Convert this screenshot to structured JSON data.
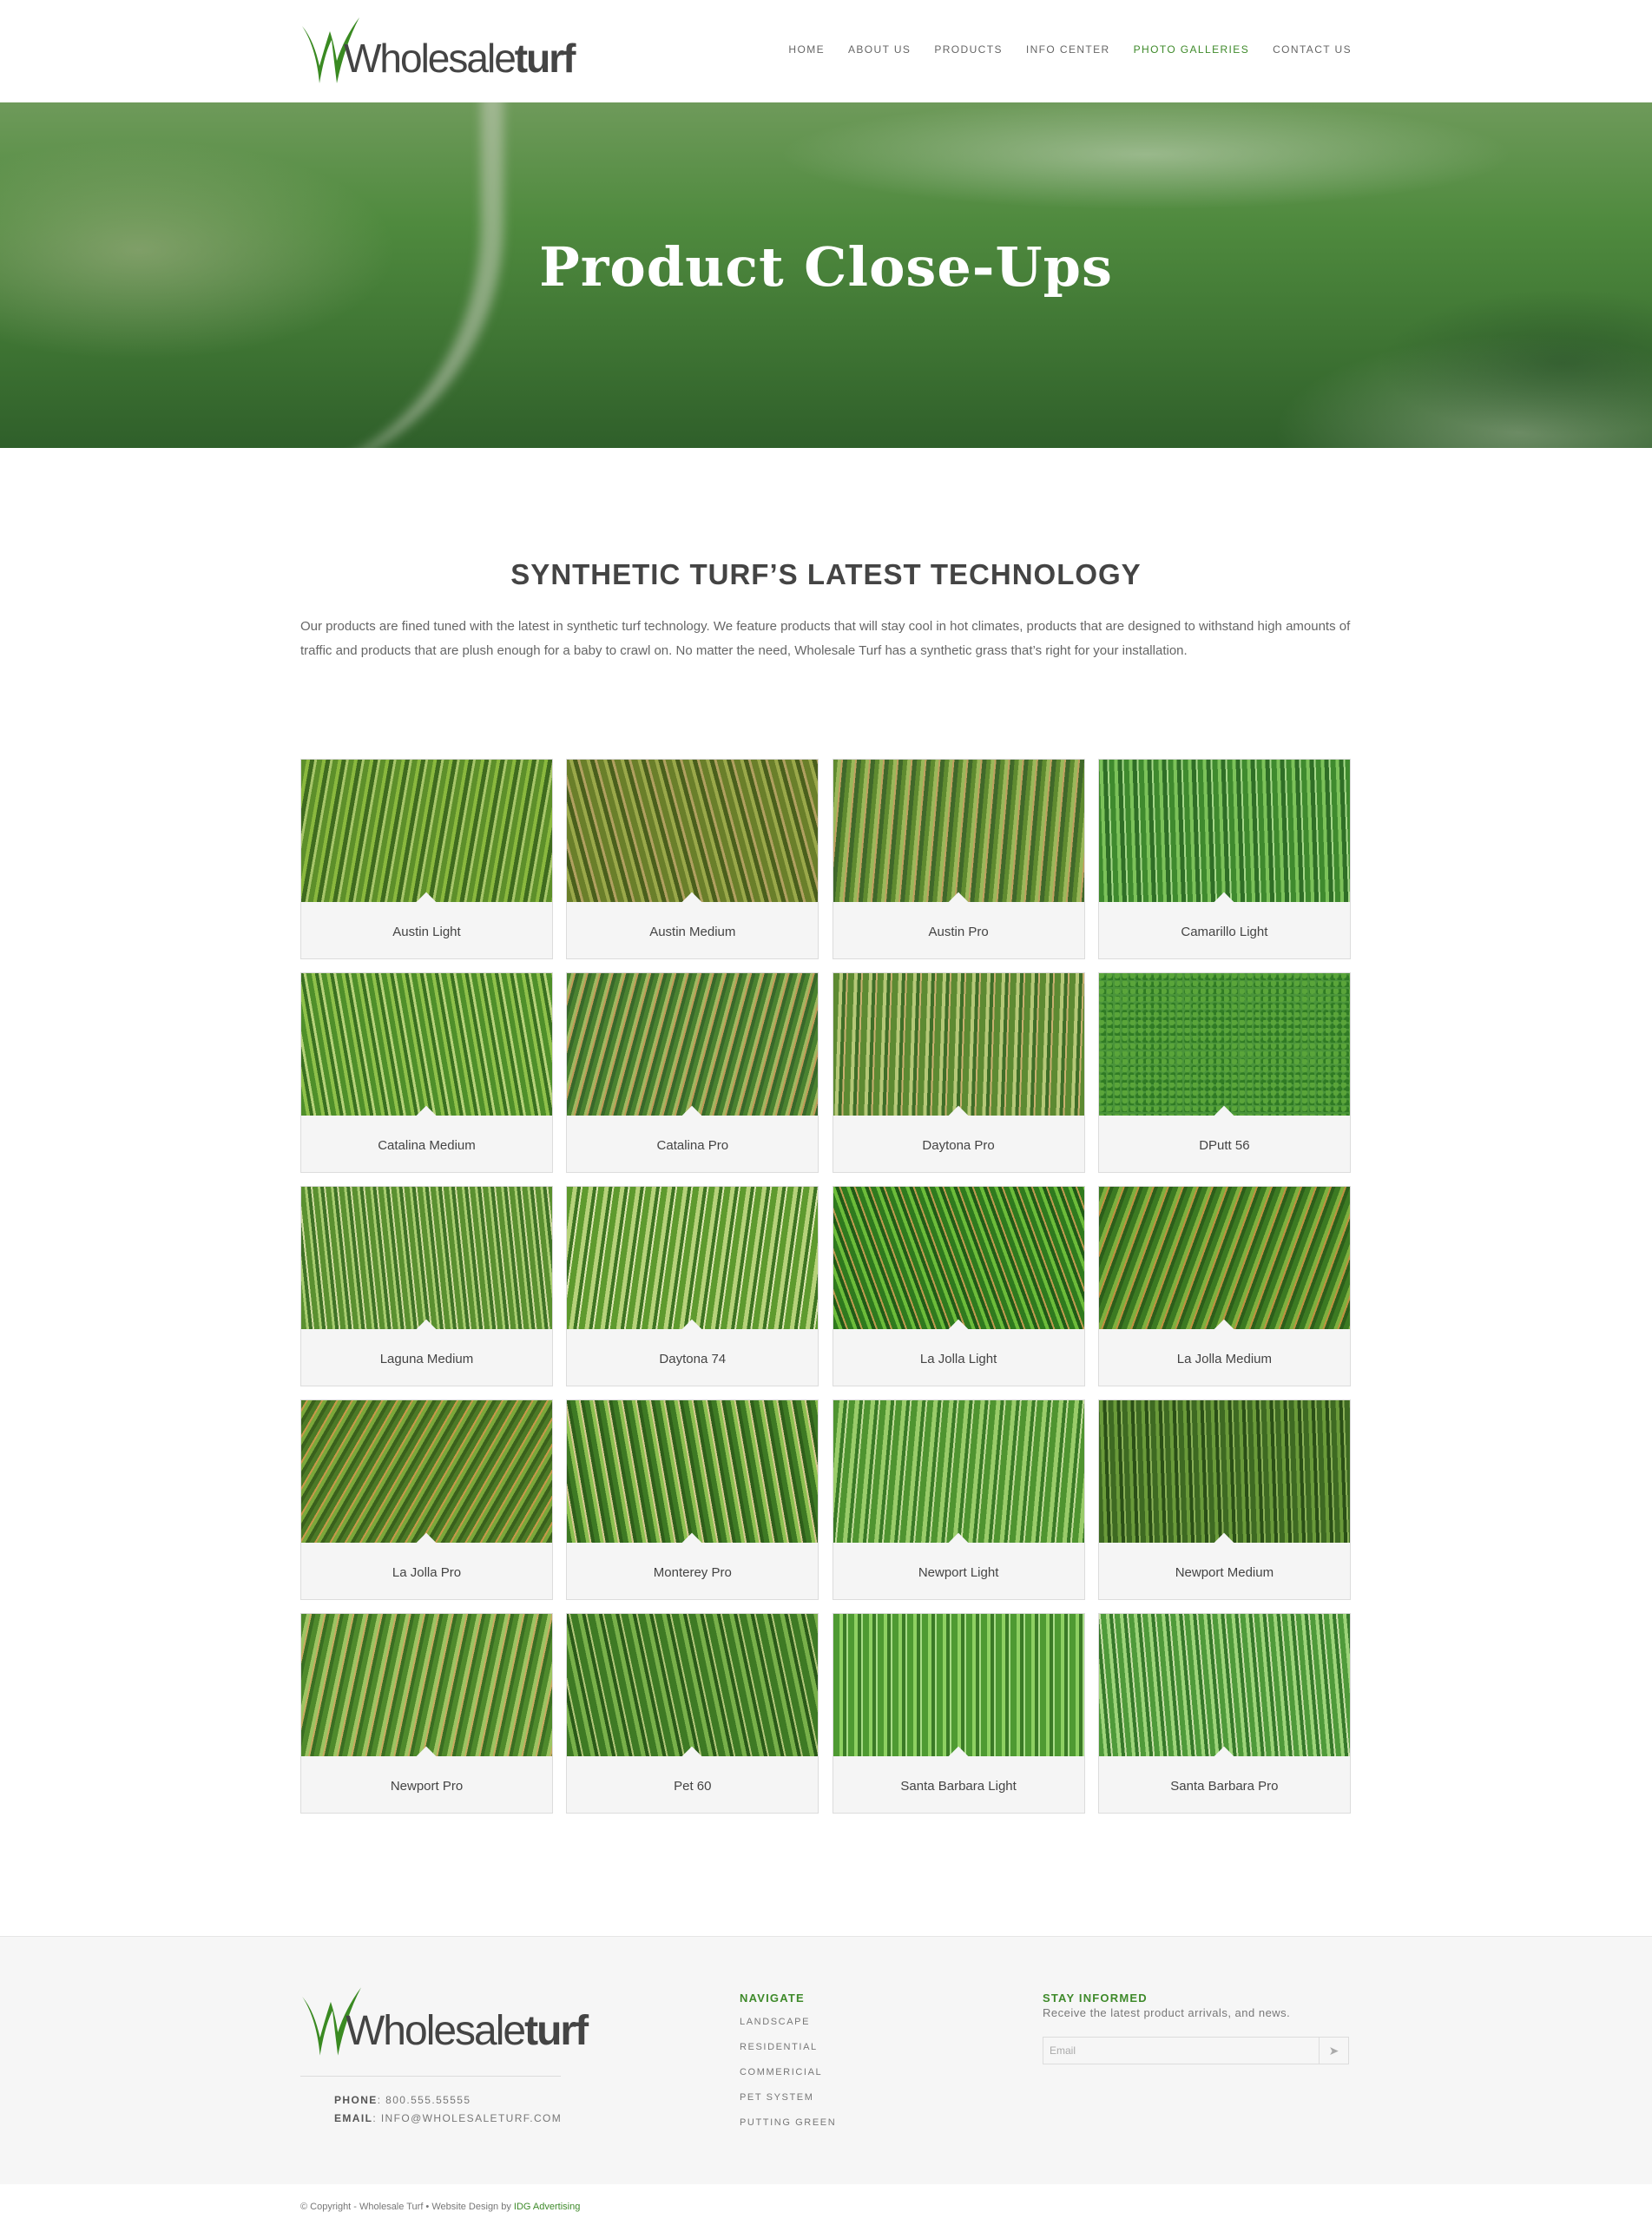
{
  "brand": {
    "logo_light": "Wholesale",
    "logo_bold": "turf",
    "accent": "#3e8a2a"
  },
  "nav": {
    "items": [
      {
        "label": "HOME"
      },
      {
        "label": "ABOUT US"
      },
      {
        "label": "PRODUCTS"
      },
      {
        "label": "INFO CENTER"
      },
      {
        "label": "PHOTO GALLERIES",
        "active": true
      },
      {
        "label": "CONTACT US"
      }
    ]
  },
  "hero": {
    "title": "Product Close-Ups"
  },
  "intro": {
    "title_light": "SYNTHETIC TURF’S",
    "title_bold": "LATEST TECHNOLOGY",
    "text": "Our products are fined tuned with the latest in synthetic turf technology. We feature products that will stay cool in hot climates, products that are designed to withstand high amounts of traffic and products that are plush enough for a baby to crawl on. No matter the need, Wholesale Turf has a synthetic grass that’s right for your installation."
  },
  "products": [
    "Austin Light",
    "Austin Medium",
    "Austin Pro",
    "Camarillo Light",
    "Catalina Medium",
    "Catalina Pro",
    "Daytona Pro",
    "DPutt 56",
    "Laguna Medium",
    "Daytona 74",
    "La Jolla Light",
    "La Jolla Medium",
    "La Jolla Pro",
    "Monterey Pro",
    "Newport Light",
    "Newport Medium",
    "Newport Pro",
    "Pet 60",
    "Santa Barbara Light",
    "Santa Barbara Pro"
  ],
  "footer": {
    "phone_label": "PHONE",
    "phone": "800.555.55555",
    "email_label": "EMAIL",
    "email": "INFO@WHOLESALETURF.COM",
    "navigate_heading": "NAVIGATE",
    "navigate_links": [
      "LANDSCAPE",
      "RESIDENTIAL",
      "COMMERICIAL",
      "PET SYSTEM",
      "PUTTING GREEN"
    ],
    "stay_heading": "STAY INFORMED",
    "stay_text": "Receive the latest product arrivals, and news.",
    "email_placeholder": "Email",
    "submit_icon": "send-arrow-icon"
  },
  "copyright": {
    "text": "© Copyright - Wholesale Turf • Website Design by",
    "link": "IDG Advertising"
  }
}
